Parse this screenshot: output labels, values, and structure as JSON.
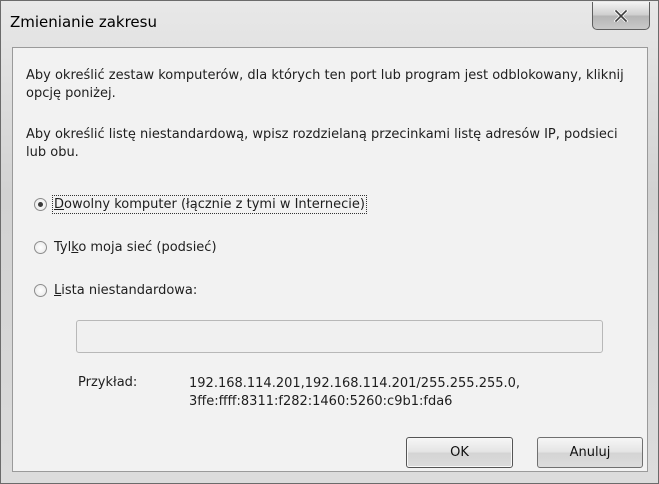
{
  "window": {
    "title": "Zmienianie zakresu",
    "close_icon": "close-x-icon"
  },
  "description": {
    "para1": "Aby określić zestaw komputerów, dla których ten port lub program jest odblokowany, kliknij opcję poniżej.",
    "para2": "Aby określić listę niestandardową, wpisz rozdzielaną przecinkami listę adresów IP, podsieci lub obu."
  },
  "options": [
    {
      "label_pre": "",
      "label_key": "D",
      "label_post": "owolny komputer (łącznie z tymi w Internecie)",
      "checked": true
    },
    {
      "label_pre": "Tyl",
      "label_key": "k",
      "label_post": "o moja sieć (podsieć)",
      "checked": false
    },
    {
      "label_pre": "",
      "label_key": "L",
      "label_post": "ista niestandardowa:",
      "checked": false
    }
  ],
  "custom_list": {
    "value": "",
    "disabled": true
  },
  "example": {
    "label": "Przykład:",
    "value": "192.168.114.201,192.168.114.201/255.255.255.0,\n3ffe:ffff:8311:f282:1460:5260:c9b1:fda6"
  },
  "buttons": {
    "ok": "OK",
    "cancel": "Anuluj"
  }
}
